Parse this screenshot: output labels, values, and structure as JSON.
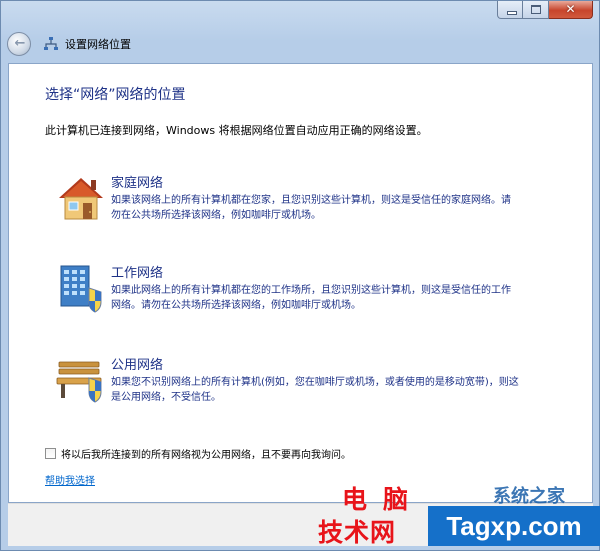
{
  "window": {
    "nav_title": "设置网络位置"
  },
  "content": {
    "heading": "选择“网络”网络的位置",
    "intro": "此计算机已连接到网络，Windows 将根据网络位置自动应用正确的网络设置。",
    "options": [
      {
        "title": "家庭网络",
        "desc": "如果该网络上的所有计算机都在您家，且您识别这些计算机，则这是受信任的家庭网络。请勿在公共场所选择该网络，例如咖啡厅或机场。",
        "icon": "house-icon"
      },
      {
        "title": "工作网络",
        "desc": "如果此网络上的所有计算机都在您的工作场所，且您识别这些计算机，则这是受信任的工作网络。请勿在公共场所选择该网络，例如咖啡厅或机场。",
        "icon": "office-building-icon"
      },
      {
        "title": "公用网络",
        "desc": "如果您不识别网络上的所有计算机(例如，您在咖啡厅或机场，或者使用的是移动宽带)，则这是公用网络，不受信任。",
        "icon": "park-bench-icon"
      }
    ],
    "checkbox_label": "将以后我所连接到的所有网络视为公用网络，且不要再向我询问。",
    "checkbox_checked": false,
    "help_link": "帮助我选择"
  },
  "watermark": {
    "line1": "电脑",
    "line2": "技术网",
    "brand": "系统之家",
    "domain": "Tagxp.com"
  },
  "colors": {
    "heading": "#1e3287",
    "link": "#0066cc",
    "watermark_red": "#e8141a",
    "watermark_blue": "#1570c9"
  }
}
